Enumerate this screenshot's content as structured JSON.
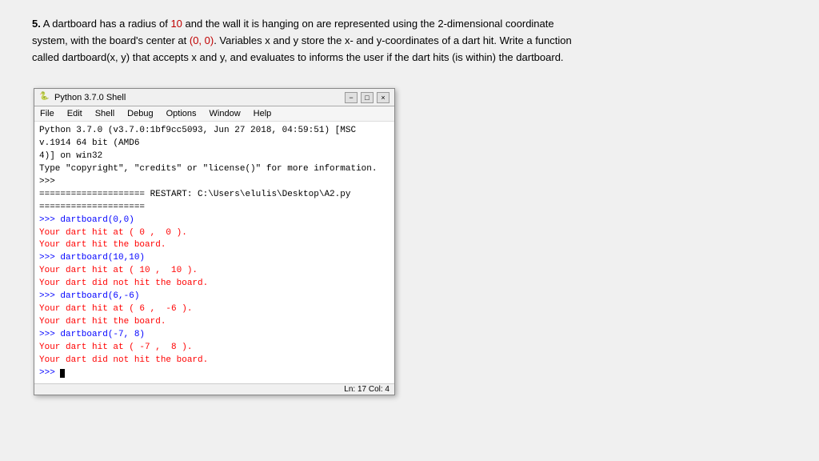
{
  "problem": {
    "number": "5.",
    "text_parts": [
      {
        "text": "A dartboard has a radius of ",
        "style": "normal"
      },
      {
        "text": "10",
        "style": "highlight"
      },
      {
        "text": " and the wall it is hanging on are represented using the 2-dimensional coordinate system, with the board's center at ",
        "style": "normal"
      },
      {
        "text": "(0, 0)",
        "style": "highlight"
      },
      {
        "text": ". Variables x and y store the x- and y-coordinates of a dart hit. Write a function called dartboard(x, y) that accepts x and y, and evaluates to informs the user if the dart hits (is within) the dartboard.",
        "style": "normal"
      }
    ]
  },
  "shell": {
    "title": "Python 3.7.0 Shell",
    "menu_items": [
      "File",
      "Edit",
      "Shell",
      "Debug",
      "Options",
      "Window",
      "Help"
    ],
    "titlebar_controls": [
      "-",
      "□",
      "×"
    ],
    "header_line1": "Python 3.7.0 (v3.7.0:1bf9cc5093, Jun 27 2018, 04:59:51) [MSC v.1914 64 bit (AMD6",
    "header_line2": "4)] on win32",
    "header_line3": "Type \"copyright\", \"credits\" or \"license()\" for more information.",
    "prompt1": ">>> ",
    "restart_line": "==================== RESTART: C:\\Users\\elulis\\Desktop\\A2.py ====================",
    "commands": [
      {
        "prompt": ">>> dartboard(0,0)",
        "output1": "Your dart hit at ( 0 ,  0 ).",
        "output2": "Your dart hit the board."
      },
      {
        "prompt": ">>> dartboard(10,10)",
        "output1": "Your dart hit at ( 10 ,  10 ).",
        "output2": "Your dart did not hit the board."
      },
      {
        "prompt": ">>> dartboard(6,-6)",
        "output1": "Your dart hit at ( 6 ,  -6 ).",
        "output2": "Your dart hit the board."
      },
      {
        "prompt": ">>> dartboard(-7, 8)",
        "output1": "Your dart hit at ( -7 ,  8 ).",
        "output2": "Your dart did not hit the board."
      }
    ],
    "final_prompt": ">>> ",
    "statusbar": "Ln: 17  Col: 4"
  }
}
